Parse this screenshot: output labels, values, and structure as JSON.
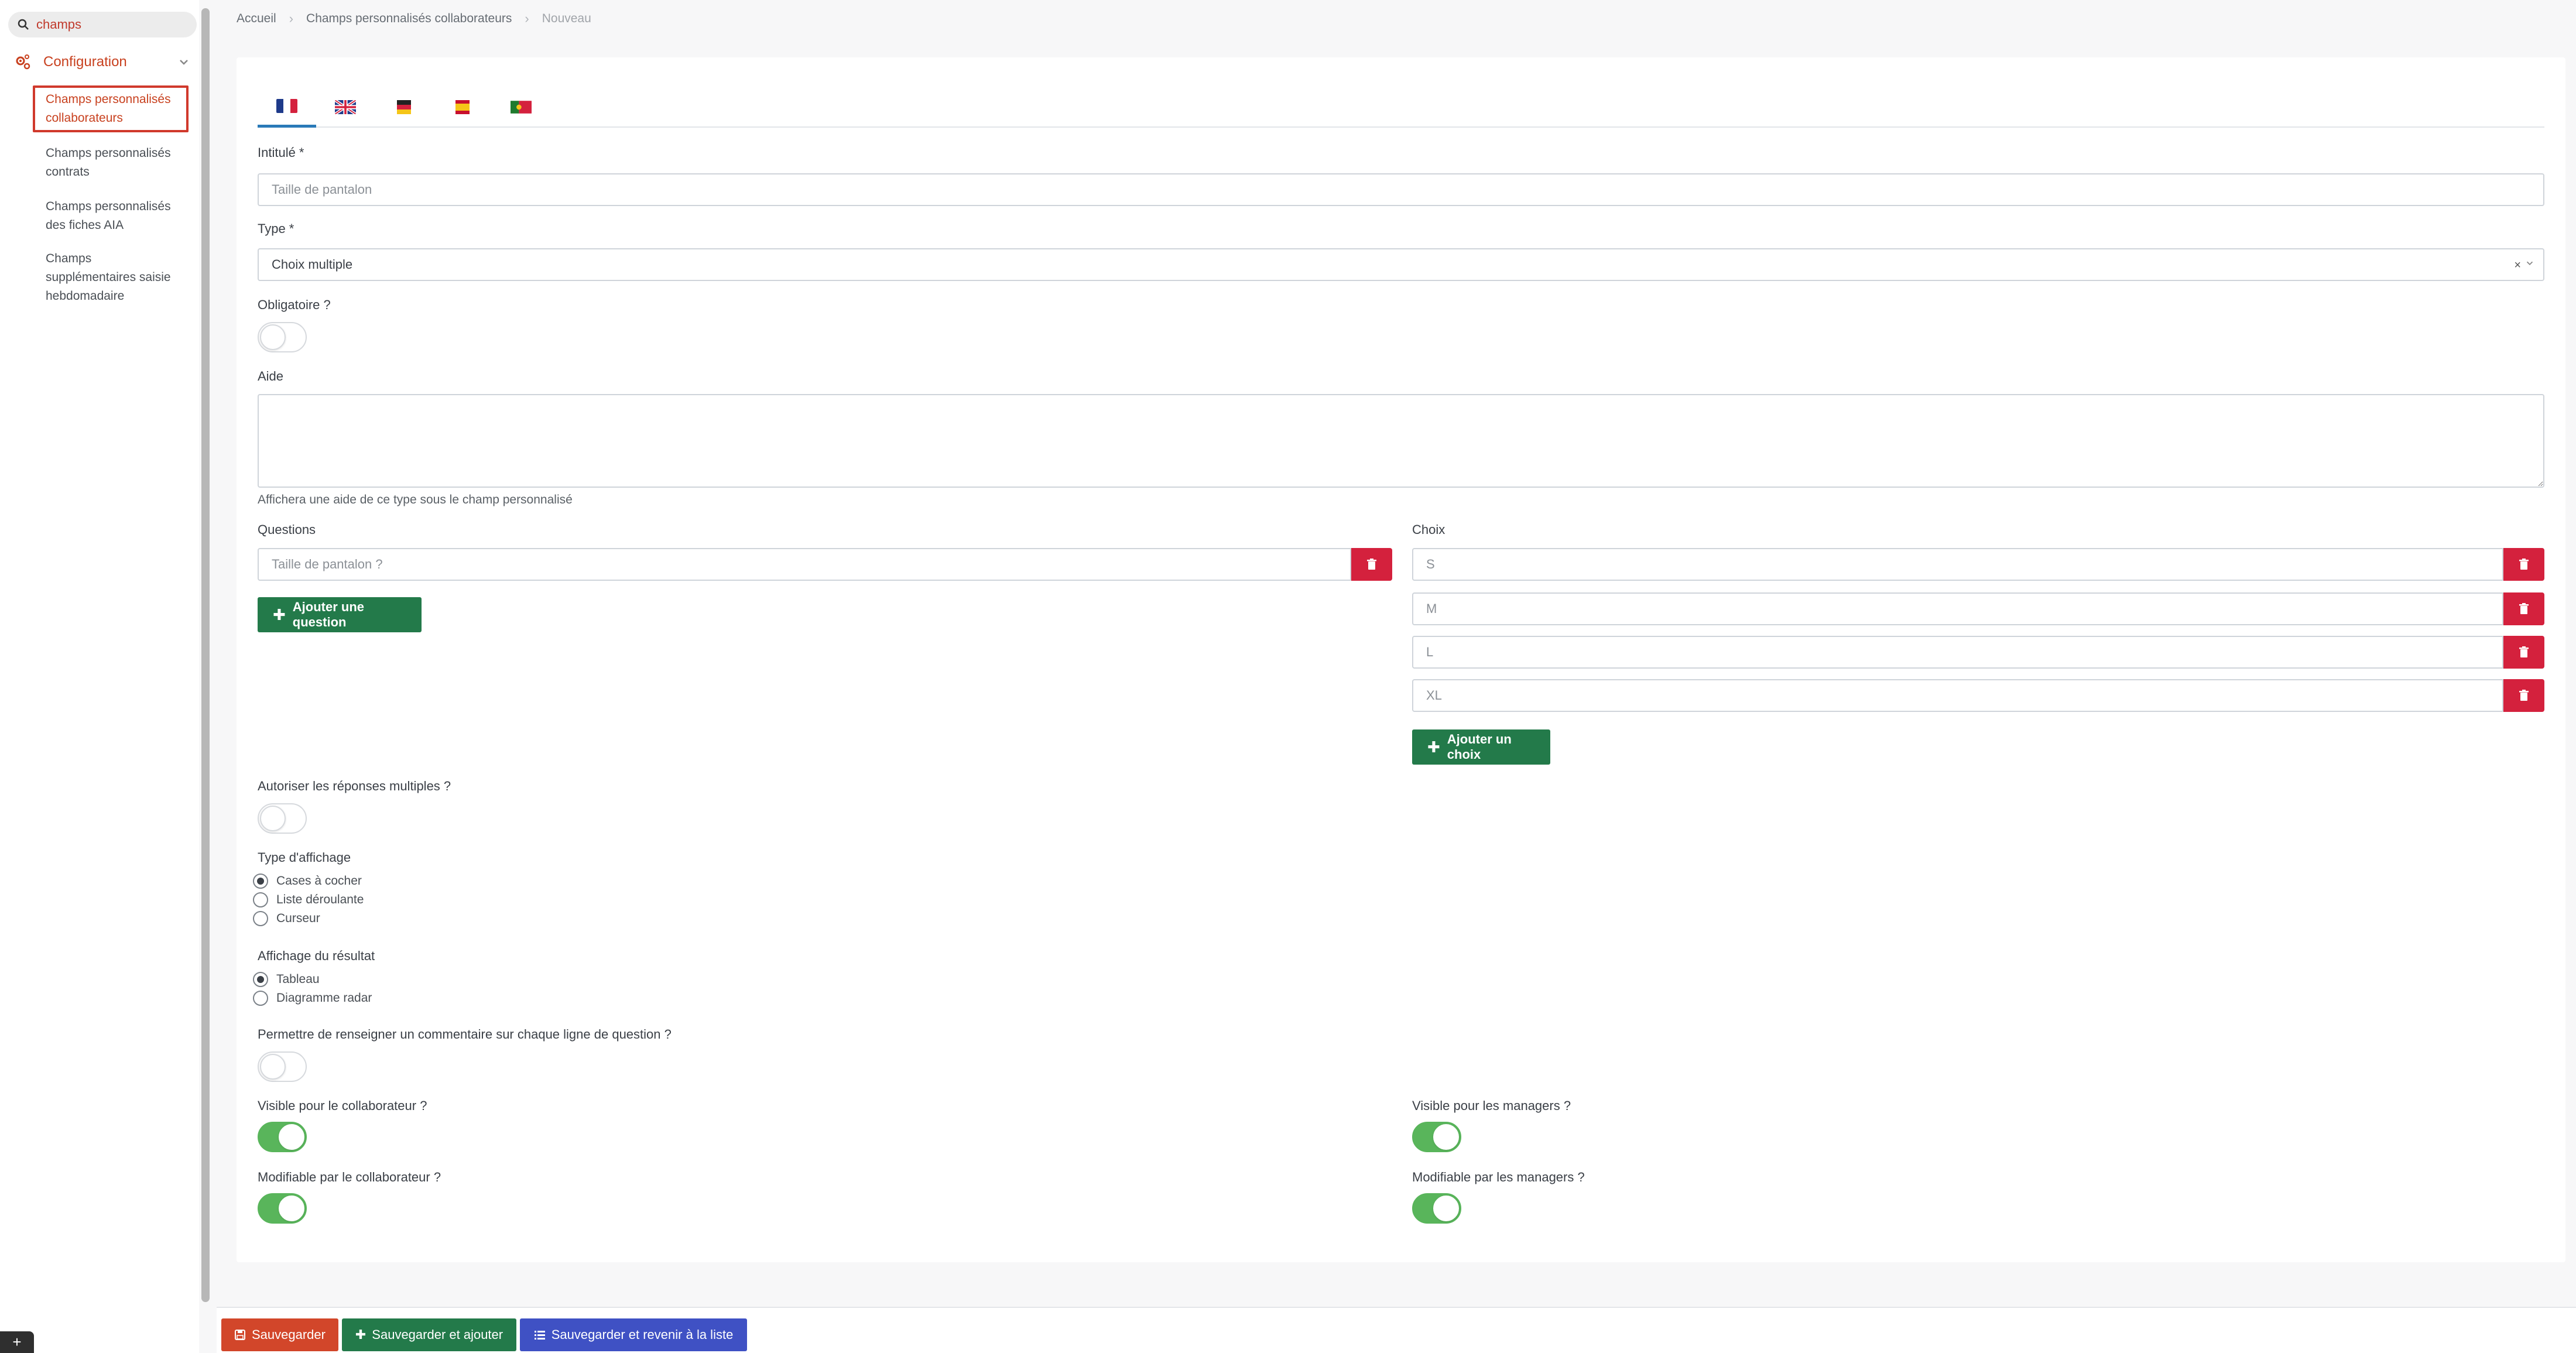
{
  "sidebar": {
    "search_value": "champs",
    "config_label": "Configuration",
    "items": [
      "Champs personnalisés collaborateurs",
      "Champs personnalisés contrats",
      "Champs personnalisés des fiches AIA",
      "Champs supplémentaires saisie hebdomadaire"
    ]
  },
  "breadcrumb": [
    "Accueil",
    "Champs personnalisés collaborateurs",
    "Nouveau"
  ],
  "form": {
    "languages": [
      "fr-flag-icon",
      "gb-flag-icon",
      "de-flag-icon",
      "es-flag-icon",
      "pt-flag-icon"
    ],
    "title_label": "Intitulé *",
    "title_placeholder": "Taille de pantalon",
    "type_label": "Type *",
    "type_value": "Choix multiple",
    "type_clear": "×",
    "required_label": "Obligatoire ?",
    "required_on": false,
    "help_label": "Aide",
    "help_hint": "Affichera une aide de ce type sous le champ personnalisé",
    "questions_label": "Questions",
    "questions": [
      "Taille de pantalon ?"
    ],
    "add_question": "Ajouter une question",
    "choices_label": "Choix",
    "choices": [
      "S",
      "M",
      "L",
      "XL"
    ],
    "add_choice": "Ajouter un choix",
    "multi_label": "Autoriser les réponses multiples ?",
    "multi_on": false,
    "display_type_label": "Type d'affichage",
    "display_type_options": [
      "Cases à cocher",
      "Liste déroulante",
      "Curseur"
    ],
    "display_type_selected": 0,
    "result_label": "Affichage du résultat",
    "result_options": [
      "Tableau",
      "Diagramme radar"
    ],
    "result_selected": 0,
    "comment_label": "Permettre de renseigner un commentaire sur chaque ligne de question ?",
    "comment_on": false,
    "visible_collab_label": "Visible pour le collaborateur ?",
    "visible_collab_on": true,
    "visible_managers_label": "Visible pour les managers ?",
    "visible_managers_on": true,
    "editable_collab_label": "Modifiable par le collaborateur ?",
    "editable_collab_on": true,
    "editable_managers_label": "Modifiable par les managers ?",
    "editable_managers_on": true
  },
  "footer": {
    "save": "Sauvegarder",
    "save_add": "Sauvegarder et ajouter",
    "save_back": "Sauvegarder et revenir à la liste"
  },
  "colors": {
    "accent": "#c8411f",
    "green": "#237a4a",
    "red": "#d4213d",
    "toggle_on": "#59b55b",
    "blue": "#3f51c4"
  }
}
